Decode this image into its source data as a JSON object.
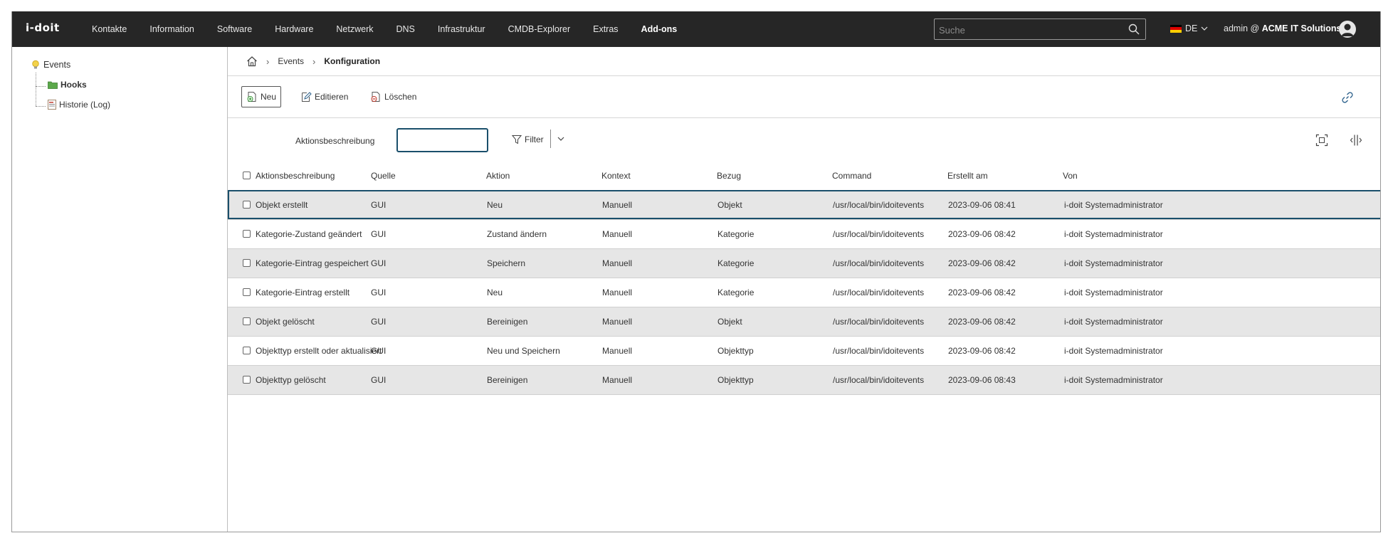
{
  "app": {
    "logo": "i-doit"
  },
  "nav": {
    "items": [
      "Kontakte",
      "Information",
      "Software",
      "Hardware",
      "Netzwerk",
      "DNS",
      "Infrastruktur",
      "CMDB-Explorer",
      "Extras",
      "Add-ons"
    ],
    "active_index": 9
  },
  "search": {
    "placeholder": "Suche",
    "value": ""
  },
  "language": {
    "label": "DE"
  },
  "user": {
    "prefix": "admin @",
    "company": "ACME IT Solutions"
  },
  "sidebar": {
    "root": "Events",
    "items": [
      {
        "label": "Hooks",
        "icon": "folder-icon",
        "active": true
      },
      {
        "label": "Historie (Log)",
        "icon": "log-icon",
        "active": false
      }
    ]
  },
  "breadcrumb": {
    "parent": "Events",
    "current": "Konfiguration"
  },
  "toolbar": {
    "new": "Neu",
    "edit": "Editieren",
    "delete": "Löschen"
  },
  "filter": {
    "label": "Aktionsbeschreibung",
    "value": "",
    "button": "Filter"
  },
  "table": {
    "columns": [
      "Aktionsbeschreibung",
      "Quelle",
      "Aktion",
      "Kontext",
      "Bezug",
      "Command",
      "Erstellt am",
      "Von"
    ],
    "rows": [
      [
        "Objekt erstellt",
        "GUI",
        "Neu",
        "Manuell",
        "Objekt",
        "/usr/local/bin/idoitevents",
        "2023-09-06 08:41",
        "i-doit Systemadministrator"
      ],
      [
        "Kategorie-Zustand geändert",
        "GUI",
        "Zustand ändern",
        "Manuell",
        "Kategorie",
        "/usr/local/bin/idoitevents",
        "2023-09-06 08:42",
        "i-doit Systemadministrator"
      ],
      [
        "Kategorie-Eintrag gespeichert",
        "GUI",
        "Speichern",
        "Manuell",
        "Kategorie",
        "/usr/local/bin/idoitevents",
        "2023-09-06 08:42",
        "i-doit Systemadministrator"
      ],
      [
        "Kategorie-Eintrag erstellt",
        "GUI",
        "Neu",
        "Manuell",
        "Kategorie",
        "/usr/local/bin/idoitevents",
        "2023-09-06 08:42",
        "i-doit Systemadministrator"
      ],
      [
        "Objekt gelöscht",
        "GUI",
        "Bereinigen",
        "Manuell",
        "Objekt",
        "/usr/local/bin/idoitevents",
        "2023-09-06 08:42",
        "i-doit Systemadministrator"
      ],
      [
        "Objekttyp erstellt oder aktualisiert",
        "GUI",
        "Neu und Speichern",
        "Manuell",
        "Objekttyp",
        "/usr/local/bin/idoitevents",
        "2023-09-06 08:42",
        "i-doit Systemadministrator"
      ],
      [
        "Objekttyp gelöscht",
        "GUI",
        "Bereinigen",
        "Manuell",
        "Objekttyp",
        "/usr/local/bin/idoitevents",
        "2023-09-06 08:43",
        "i-doit Systemadministrator"
      ]
    ],
    "selected_index": 0
  },
  "colors": {
    "topbar": "#262626",
    "accent": "#1a4f6b",
    "row_alt": "#e6e6e6"
  }
}
